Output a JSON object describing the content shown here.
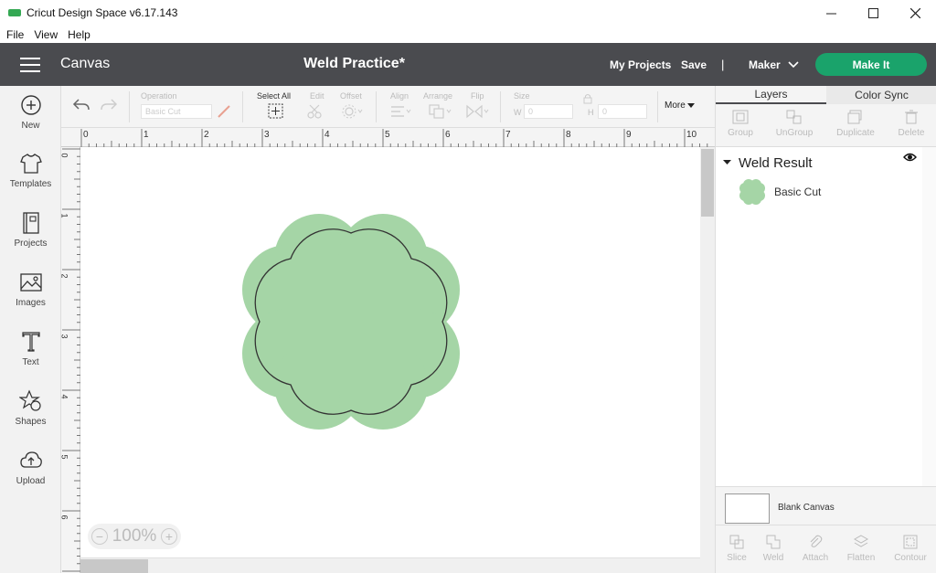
{
  "window": {
    "title": "Cricut Design Space  v6.17.143"
  },
  "menu": [
    "File",
    "View",
    "Help"
  ],
  "header": {
    "section": "Canvas",
    "project": "Weld Practice*",
    "my_projects": "My Projects",
    "save": "Save",
    "separator": "|",
    "machine": "Maker",
    "make_it": "Make It"
  },
  "sidebar": {
    "new": "New",
    "templates": "Templates",
    "projects": "Projects",
    "images": "Images",
    "text": "Text",
    "shapes": "Shapes",
    "upload": "Upload"
  },
  "toolbar": {
    "operation": "Operation",
    "operation_value": "Basic Cut",
    "select_all": "Select All",
    "edit": "Edit",
    "offset": "Offset",
    "align": "Align",
    "arrange": "Arrange",
    "flip": "Flip",
    "size": "Size",
    "w_label": "W",
    "w_value": "0",
    "h_label": "H",
    "h_value": "0",
    "more": "More"
  },
  "ruler": {
    "top": [
      "0",
      "1",
      "2",
      "3",
      "4",
      "5",
      "6",
      "7",
      "8",
      "9",
      "10"
    ],
    "left": [
      "0",
      "1",
      "2",
      "3",
      "4",
      "5",
      "6"
    ]
  },
  "zoom": {
    "minus": "−",
    "value": "100%",
    "plus": "+"
  },
  "panel": {
    "tabs": [
      "Layers",
      "Color Sync"
    ],
    "actions": [
      "Group",
      "UnGroup",
      "Duplicate",
      "Delete"
    ],
    "group_name": "Weld Result",
    "layer_name": "Basic Cut",
    "blank_canvas": "Blank Canvas",
    "bottom": [
      "Slice",
      "Weld",
      "Attach",
      "Flatten",
      "Contour"
    ]
  },
  "colors": {
    "header_bg": "#4a4b4f",
    "make_it_bg": "#1aa36b",
    "shape_fill": "#a5d5a6",
    "shape_stroke": "#333333"
  }
}
